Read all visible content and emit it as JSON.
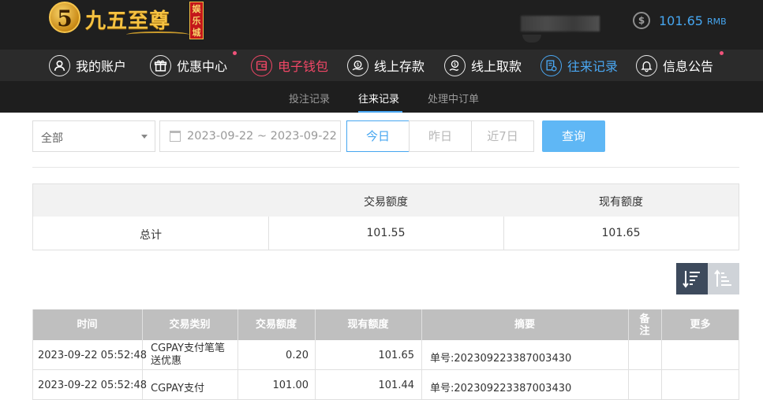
{
  "brand": {
    "logo_numeral": "5",
    "logo_text": "九五至尊",
    "logo_badge": "娱乐城"
  },
  "account": {
    "currency_icon": "$",
    "balance": "101.65",
    "unit": "RMB"
  },
  "nav": [
    {
      "label": "我的账户",
      "icon": "user-icon",
      "dot": false
    },
    {
      "label": "优惠中心",
      "icon": "gift-icon",
      "dot": true
    },
    {
      "label": "电子钱包",
      "icon": "wallet-icon",
      "dot": false,
      "active_color": "#f04766"
    },
    {
      "label": "线上存款",
      "icon": "deposit-icon",
      "dot": false
    },
    {
      "label": "线上取款",
      "icon": "withdraw-icon",
      "dot": false
    },
    {
      "label": "往来记录",
      "icon": "records-icon",
      "dot": false,
      "active_color": "#4aa7f2"
    },
    {
      "label": "信息公告",
      "icon": "bell-icon",
      "dot": true
    }
  ],
  "subtabs": [
    {
      "label": "投注记录",
      "active": false
    },
    {
      "label": "往来记录",
      "active": true
    },
    {
      "label": "处理中订单",
      "active": false
    }
  ],
  "filters": {
    "type_select": "全部",
    "date_range": "2023-09-22 ~ 2023-09-22",
    "quick_ranges": [
      {
        "label": "今日",
        "active": true
      },
      {
        "label": "昨日",
        "active": false
      },
      {
        "label": "近7日",
        "active": false
      }
    ],
    "query_label": "查询"
  },
  "summary": {
    "headers": [
      "",
      "交易额度",
      "现有额度"
    ],
    "row": [
      "总计",
      "101.55",
      "101.65"
    ]
  },
  "records": {
    "headers": [
      "时间",
      "交易类别",
      "交易额度",
      "现有额度",
      "摘要",
      "备注",
      "更多"
    ],
    "rows": [
      [
        "2023-09-22 05:52:48",
        "CGPAY支付笔笔送优惠",
        "0.20",
        "101.65",
        "单号:20230922338700343​0",
        "",
        ""
      ],
      [
        "2023-09-22 05:52:48",
        "CGPAY支付",
        "101.00",
        "101.44",
        "单号:20230922338700343​0",
        "",
        ""
      ]
    ]
  },
  "colors": {
    "accent_blue": "#4aa7f2",
    "accent_red": "#f04766",
    "header_bg": "#1f1f1f"
  }
}
